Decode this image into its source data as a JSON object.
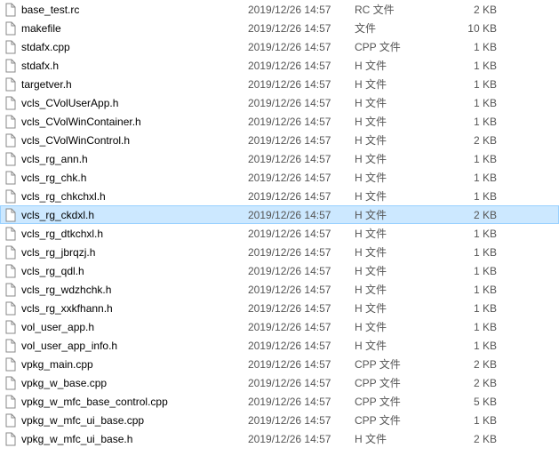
{
  "files": [
    {
      "name": "base_test.rc",
      "date": "2019/12/26 14:57",
      "type": "RC 文件",
      "size": "2 KB",
      "icon": "generic"
    },
    {
      "name": "makefile",
      "date": "2019/12/26 14:57",
      "type": "文件",
      "size": "10 KB",
      "icon": "generic"
    },
    {
      "name": "stdafx.cpp",
      "date": "2019/12/26 14:57",
      "type": "CPP 文件",
      "size": "1 KB",
      "icon": "generic"
    },
    {
      "name": "stdafx.h",
      "date": "2019/12/26 14:57",
      "type": "H 文件",
      "size": "1 KB",
      "icon": "generic"
    },
    {
      "name": "targetver.h",
      "date": "2019/12/26 14:57",
      "type": "H 文件",
      "size": "1 KB",
      "icon": "generic"
    },
    {
      "name": "vcls_CVolUserApp.h",
      "date": "2019/12/26 14:57",
      "type": "H 文件",
      "size": "1 KB",
      "icon": "generic"
    },
    {
      "name": "vcls_CVolWinContainer.h",
      "date": "2019/12/26 14:57",
      "type": "H 文件",
      "size": "1 KB",
      "icon": "generic"
    },
    {
      "name": "vcls_CVolWinControl.h",
      "date": "2019/12/26 14:57",
      "type": "H 文件",
      "size": "2 KB",
      "icon": "generic"
    },
    {
      "name": "vcls_rg_ann.h",
      "date": "2019/12/26 14:57",
      "type": "H 文件",
      "size": "1 KB",
      "icon": "generic"
    },
    {
      "name": "vcls_rg_chk.h",
      "date": "2019/12/26 14:57",
      "type": "H 文件",
      "size": "1 KB",
      "icon": "generic"
    },
    {
      "name": "vcls_rg_chkchxl.h",
      "date": "2019/12/26 14:57",
      "type": "H 文件",
      "size": "1 KB",
      "icon": "generic"
    },
    {
      "name": "vcls_rg_ckdxl.h",
      "date": "2019/12/26 14:57",
      "type": "H 文件",
      "size": "2 KB",
      "icon": "generic",
      "selected": true
    },
    {
      "name": "vcls_rg_dtkchxl.h",
      "date": "2019/12/26 14:57",
      "type": "H 文件",
      "size": "1 KB",
      "icon": "generic"
    },
    {
      "name": "vcls_rg_jbrqzj.h",
      "date": "2019/12/26 14:57",
      "type": "H 文件",
      "size": "1 KB",
      "icon": "generic"
    },
    {
      "name": "vcls_rg_qdl.h",
      "date": "2019/12/26 14:57",
      "type": "H 文件",
      "size": "1 KB",
      "icon": "generic"
    },
    {
      "name": "vcls_rg_wdzhchk.h",
      "date": "2019/12/26 14:57",
      "type": "H 文件",
      "size": "1 KB",
      "icon": "generic"
    },
    {
      "name": "vcls_rg_xxkfhann.h",
      "date": "2019/12/26 14:57",
      "type": "H 文件",
      "size": "1 KB",
      "icon": "generic"
    },
    {
      "name": "vol_user_app.h",
      "date": "2019/12/26 14:57",
      "type": "H 文件",
      "size": "1 KB",
      "icon": "generic"
    },
    {
      "name": "vol_user_app_info.h",
      "date": "2019/12/26 14:57",
      "type": "H 文件",
      "size": "1 KB",
      "icon": "generic"
    },
    {
      "name": "vpkg_main.cpp",
      "date": "2019/12/26 14:57",
      "type": "CPP 文件",
      "size": "2 KB",
      "icon": "generic"
    },
    {
      "name": "vpkg_w_base.cpp",
      "date": "2019/12/26 14:57",
      "type": "CPP 文件",
      "size": "2 KB",
      "icon": "generic"
    },
    {
      "name": "vpkg_w_mfc_base_control.cpp",
      "date": "2019/12/26 14:57",
      "type": "CPP 文件",
      "size": "5 KB",
      "icon": "generic"
    },
    {
      "name": "vpkg_w_mfc_ui_base.cpp",
      "date": "2019/12/26 14:57",
      "type": "CPP 文件",
      "size": "1 KB",
      "icon": "generic"
    },
    {
      "name": "vpkg_w_mfc_ui_base.h",
      "date": "2019/12/26 14:57",
      "type": "H 文件",
      "size": "2 KB",
      "icon": "generic"
    }
  ]
}
